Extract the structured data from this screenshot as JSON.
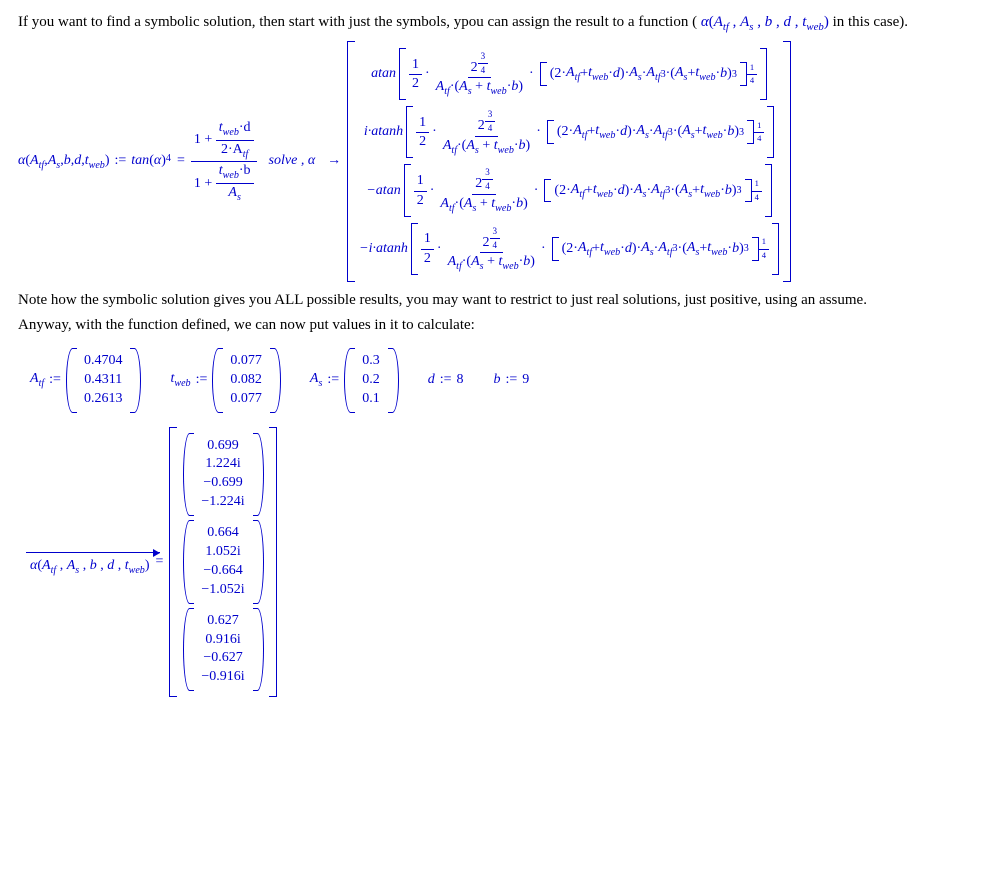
{
  "para1_a": "If you want to find a symbolic solution, then start with just the symbols, ypou can assign the result to a function ( ",
  "para1_b": " in this case).",
  "func_sig_open": "α(",
  "func_sig_args": "A_{tf} , A_{s} , b , d , t_{web}",
  "func_sig_close": ")",
  "assign": ":=",
  "tan": "tan",
  "alpha": "α",
  "pow4": "4",
  "eq": "=",
  "one_plus": "1 +",
  "num_frac_top_a": "t",
  "num_frac_top_b": "·d",
  "num_frac_bot_a": "2·A",
  "den_frac_top_a": "t",
  "den_frac_top_b": "·b",
  "den_frac_bot_a": "A",
  "solve": "solve , α",
  "arrow": "→",
  "sol_prefix": [
    "atan",
    "i·atanh",
    "−atan",
    "−i·atanh"
  ],
  "half": {
    "n": "1",
    "d": "2"
  },
  "two34": {
    "top": "3",
    "base": "2",
    "bot": "4"
  },
  "Atf": "A_{tf}",
  "As": "A_{s}",
  "tweb": "t_{web}",
  "dot": "·",
  "open_sq": "[",
  "close_sq": "]",
  "expr_a": "(2·A",
  "expr_b": " + t",
  "expr_c": "·d)·A",
  "expr_d": "·A",
  "expr_e": "·(A",
  "expr_f": " + t",
  "expr_g": "·b)",
  "cube": "3",
  "quarter": {
    "n": "1",
    "d": "4"
  },
  "para2": "Note how the symbolic solution gives you ALL possible results, you may want to restrict to just real solutions, just positive, using an assume.",
  "para3": "Anyway, with the function defined, we can now put values in it to calculate:",
  "Atf_vec": [
    "0.4704",
    "0.4311",
    "0.2613"
  ],
  "tweb_vec": [
    "0.077",
    "0.082",
    "0.077"
  ],
  "As_vec": [
    "0.3",
    "0.2",
    "0.1"
  ],
  "d_val": "8",
  "b_val": "9",
  "d_lbl": "d",
  "b_lbl": "b",
  "result_groups": [
    [
      "0.699",
      "1.224i",
      "−0.699",
      "−1.224i"
    ],
    [
      "0.664",
      "1.052i",
      "−0.664",
      "−1.052i"
    ],
    [
      "0.627",
      "0.916i",
      "−0.627",
      "−0.916i"
    ]
  ]
}
